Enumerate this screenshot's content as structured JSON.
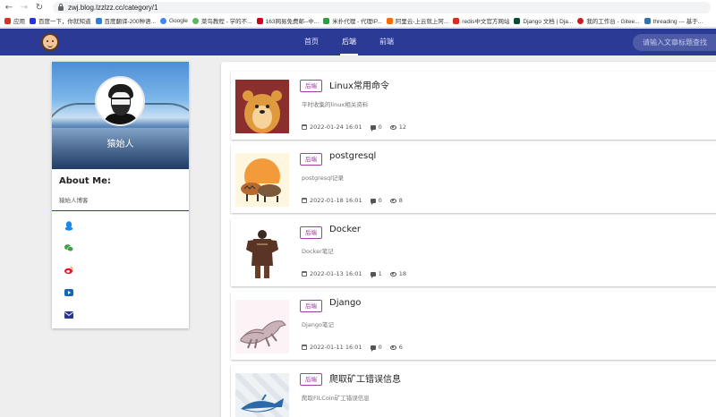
{
  "browser": {
    "url": "zwj.blog.lzzlzz.cc/category/1",
    "bookmarks": [
      {
        "label": "应用",
        "color": "#d93025"
      },
      {
        "label": "百度一下，你就知道",
        "color": "#2932e1"
      },
      {
        "label": "百度翻译-200种语...",
        "color": "#2f7fe0"
      },
      {
        "label": "Google",
        "color": "#4285f4"
      },
      {
        "label": "菜鸟教程 - 学的不...",
        "color": "#5cb85c"
      },
      {
        "label": "163网易免费邮--中...",
        "color": "#d0021b"
      },
      {
        "label": "米扑代理 - 代理IP...",
        "color": "#2e9e3e"
      },
      {
        "label": "阿里云-上云就上阿...",
        "color": "#ff6a00"
      },
      {
        "label": "redis中文官方网站",
        "color": "#d82c20"
      },
      {
        "label": "Django 文档 | Dja...",
        "color": "#0c4b33"
      },
      {
        "label": "我的工作台 - Gitee...",
        "color": "#c71d23"
      },
      {
        "label": "threading --- 基于...",
        "color": "#3572a5"
      }
    ]
  },
  "nav": {
    "items": [
      {
        "label": "首页",
        "active": false
      },
      {
        "label": "后端",
        "active": true
      },
      {
        "label": "前端",
        "active": false
      }
    ],
    "search_placeholder": "请输入文章标题查找"
  },
  "profile": {
    "nickname": "猿始人",
    "about_title": "About Me:",
    "about_text": "猿始人博客",
    "social_icons": [
      "qq-icon",
      "wechat-icon",
      "weibo-icon",
      "youtube-icon",
      "email-icon"
    ],
    "social_colors": [
      "#1e88e5",
      "#43a047",
      "#e6162d",
      "#1565c0",
      "#283593"
    ]
  },
  "articles": [
    {
      "tag": "后端",
      "title": "Linux常用命令",
      "summary": "平时收集的linux相关资料",
      "date": "2022-01-24 16:01",
      "comments": "0",
      "views": "12"
    },
    {
      "tag": "后端",
      "title": "postgresql",
      "summary": "postgresql记录",
      "date": "2022-01-18 16:01",
      "comments": "0",
      "views": "8"
    },
    {
      "tag": "后端",
      "title": "Docker",
      "summary": "Docker笔记",
      "date": "2022-01-13 16:01",
      "comments": "1",
      "views": "18"
    },
    {
      "tag": "后端",
      "title": "Django",
      "summary": "Django笔记",
      "date": "2022-01-11 16:01",
      "comments": "0",
      "views": "6"
    },
    {
      "tag": "后端",
      "title": "爬取矿工错误信息",
      "summary": "爬取FILCoin矿工错误信息"
    }
  ]
}
